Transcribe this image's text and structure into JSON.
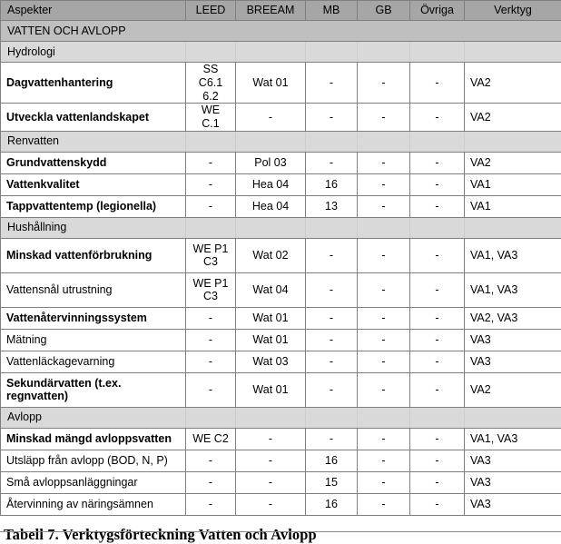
{
  "table": {
    "columns": [
      {
        "key": "aspekt",
        "label": "Aspekter"
      },
      {
        "key": "leed",
        "label": "LEED"
      },
      {
        "key": "breeam",
        "label": "BREEAM"
      },
      {
        "key": "mb",
        "label": "MB"
      },
      {
        "key": "gb",
        "label": "GB"
      },
      {
        "key": "ovriga",
        "label": "Övriga"
      },
      {
        "key": "verktyg",
        "label": "Verktyg"
      }
    ],
    "category_band": "VATTEN OCH AVLOPP",
    "sections": [
      {
        "title": "Hydrologi",
        "rows": [
          {
            "aspekt": "Dagvattenhantering",
            "bold": true,
            "leed": "SS C6.1 6.2",
            "breeam": "Wat 01",
            "mb": "-",
            "gb": "-",
            "ovriga": "-",
            "verktyg": "VA2",
            "tall": true
          },
          {
            "aspekt": "Utveckla vattenlandskapet",
            "bold": true,
            "leed": "WE C.1",
            "breeam": "-",
            "mb": "-",
            "gb": "-",
            "ovriga": "-",
            "verktyg": "VA2",
            "tall": false
          }
        ]
      },
      {
        "title": "Renvatten",
        "rows": [
          {
            "aspekt": "Grundvattenskydd",
            "bold": true,
            "leed": "-",
            "breeam": "Pol 03",
            "mb": "-",
            "gb": "-",
            "ovriga": "-",
            "verktyg": "VA2",
            "tall": false
          },
          {
            "aspekt": "Vattenkvalitet",
            "bold": true,
            "leed": "-",
            "breeam": "Hea 04",
            "mb": "16",
            "gb": "-",
            "ovriga": "-",
            "verktyg": "VA1",
            "tall": false
          },
          {
            "aspekt": "Tappvattentemp (legionella)",
            "bold": true,
            "leed": "-",
            "breeam": "Hea 04",
            "mb": "13",
            "gb": "-",
            "ovriga": "-",
            "verktyg": "VA1",
            "tall": false
          }
        ]
      },
      {
        "title": "Hushållning",
        "rows": [
          {
            "aspekt": "Minskad vattenförbrukning",
            "bold": true,
            "leed": "WE P1 C3",
            "breeam": "Wat 02",
            "mb": "-",
            "gb": "-",
            "ovriga": "-",
            "verktyg": "VA1, VA3",
            "tall": true
          },
          {
            "aspekt": "Vattensnål utrustning",
            "bold": false,
            "leed": "WE P1 C3",
            "breeam": "Wat 04",
            "mb": "-",
            "gb": "-",
            "ovriga": "-",
            "verktyg": "VA1, VA3",
            "tall": true
          },
          {
            "aspekt": "Vattenåtervinningssystem",
            "bold": true,
            "leed": "-",
            "breeam": "Wat 01",
            "mb": "-",
            "gb": "-",
            "ovriga": "-",
            "verktyg": "VA2, VA3",
            "tall": false
          },
          {
            "aspekt": "Mätning",
            "bold": false,
            "leed": "-",
            "breeam": "Wat 01",
            "mb": "-",
            "gb": "-",
            "ovriga": "-",
            "verktyg": "VA3",
            "tall": false
          },
          {
            "aspekt": "Vattenläckagevarning",
            "bold": false,
            "leed": "-",
            "breeam": "Wat 03",
            "mb": "-",
            "gb": "-",
            "ovriga": "-",
            "verktyg": "VA3",
            "tall": false
          },
          {
            "aspekt": "Sekundärvatten (t.ex. regnvatten)",
            "bold": true,
            "leed": "-",
            "breeam": "Wat 01",
            "mb": "-",
            "gb": "-",
            "ovriga": "-",
            "verktyg": "VA2",
            "tall": true
          }
        ]
      },
      {
        "title": "Avlopp",
        "rows": [
          {
            "aspekt": "Minskad mängd avloppsvatten",
            "bold": true,
            "leed": "WE C2",
            "breeam": "-",
            "mb": "-",
            "gb": "-",
            "ovriga": "-",
            "verktyg": "VA1, VA3",
            "tall": false
          },
          {
            "aspekt": "Utsläpp från avlopp (BOD, N, P)",
            "bold": false,
            "leed": "-",
            "breeam": "-",
            "mb": "16",
            "gb": "-",
            "ovriga": "-",
            "verktyg": "VA3",
            "tall": false
          },
          {
            "aspekt": "Små avloppsanläggningar",
            "bold": false,
            "leed": "-",
            "breeam": "-",
            "mb": "15",
            "gb": "-",
            "ovriga": "-",
            "verktyg": "VA3",
            "tall": false
          },
          {
            "aspekt": "Återvinning av näringsämnen",
            "bold": false,
            "leed": "-",
            "breeam": "-",
            "mb": "16",
            "gb": "-",
            "ovriga": "-",
            "verktyg": "VA3",
            "tall": false
          }
        ]
      }
    ]
  },
  "caption": "Tabell 7. Verktygsförteckning Vatten och Avlopp",
  "colors": {
    "header_bg": "#a6a6a6",
    "band_bg": "#bfbfbf",
    "section_bg": "#d9d9d9",
    "border": "#7f7f7f",
    "text": "#000000"
  }
}
